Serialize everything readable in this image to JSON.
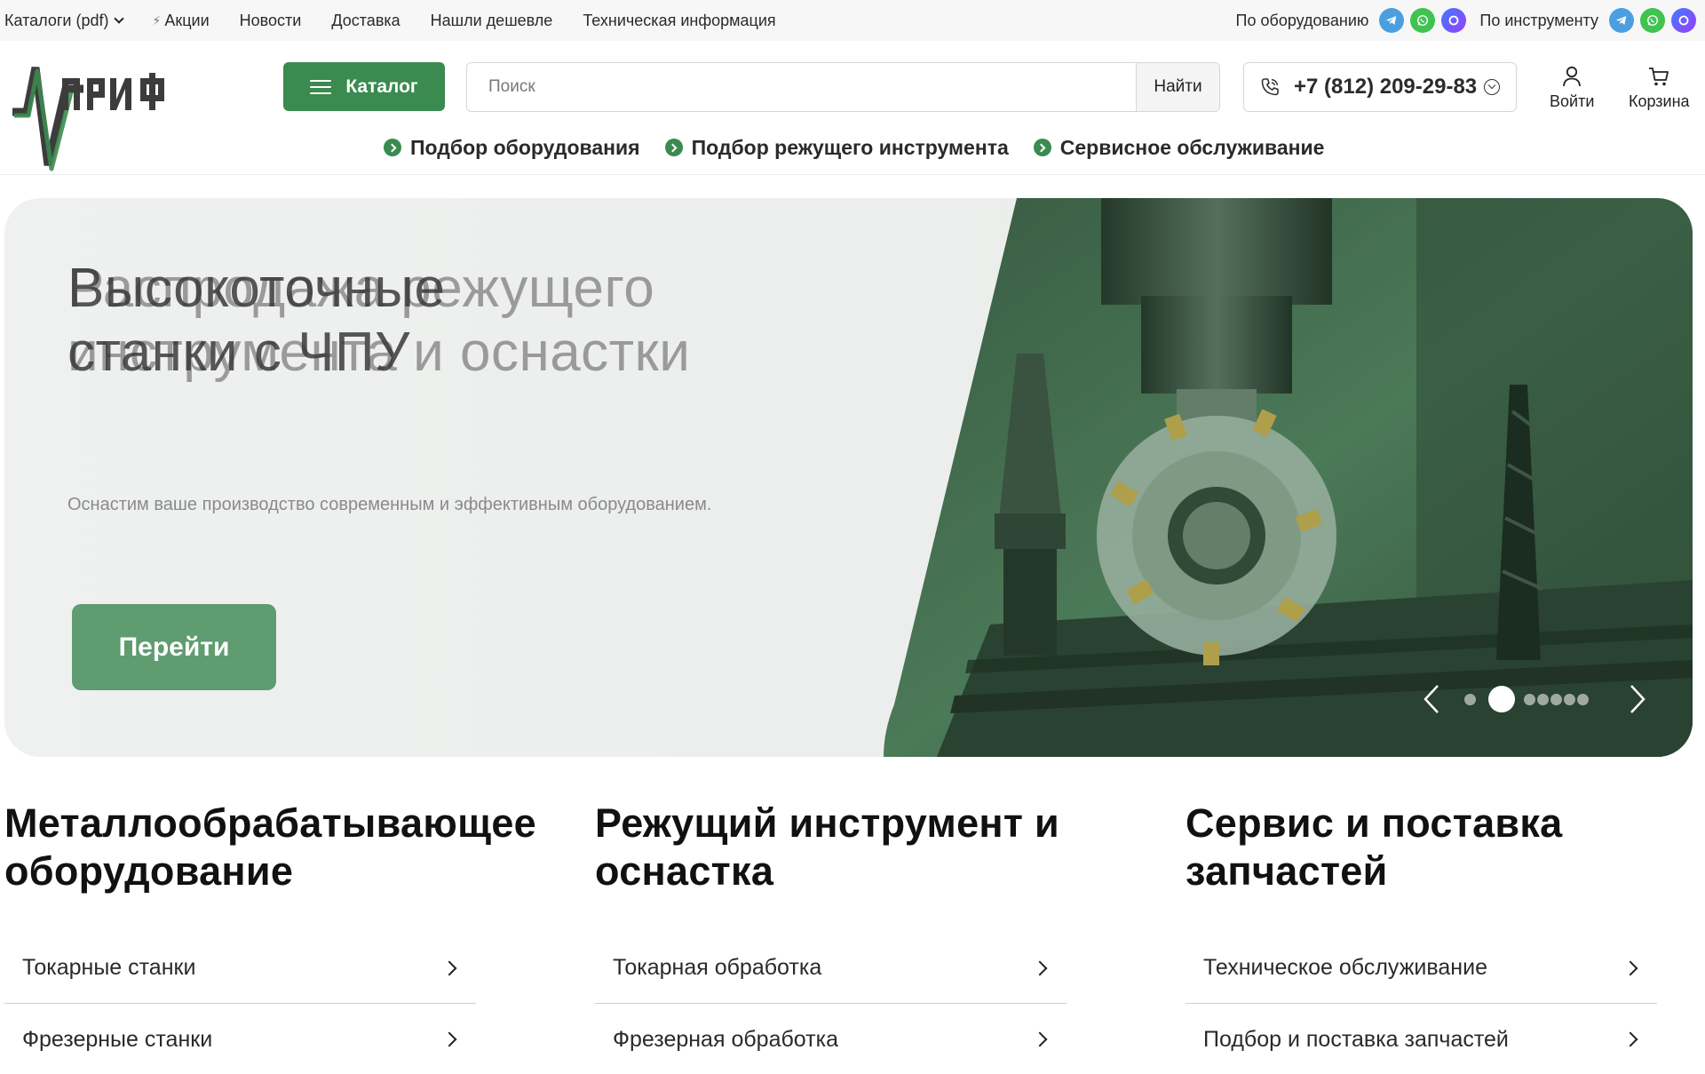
{
  "topbar": {
    "nav": [
      {
        "label": "Каталоги (pdf)",
        "has_dropdown": true
      },
      {
        "label": "Акции",
        "icon": "bolt-icon"
      },
      {
        "label": "Новости"
      },
      {
        "label": "Доставка"
      },
      {
        "label": "Нашли дешевле"
      },
      {
        "label": "Техническая информация"
      }
    ],
    "contacts": [
      {
        "label": "По оборудованию",
        "messengers": [
          "telegram-icon",
          "whatsapp-icon",
          "max-messenger-icon"
        ]
      },
      {
        "label": "По инструменту",
        "messengers": [
          "telegram-icon",
          "whatsapp-icon",
          "max-messenger-icon"
        ]
      }
    ]
  },
  "header": {
    "logo_alt": "Арифм",
    "catalog_label": "Каталог",
    "search": {
      "placeholder": "Поиск",
      "value": "",
      "button_label": "Найти"
    },
    "phone": "+7 (812) 209-29-83",
    "login_label": "Войти",
    "cart_label": "Корзина",
    "subnav": [
      {
        "label": "Подбор оборудования"
      },
      {
        "label": "Подбор режущего инструмента"
      },
      {
        "label": "Сервисное обслуживание"
      }
    ]
  },
  "hero": {
    "title_primary": "Распродажа режущего инструмента и оснастки",
    "title_secondary": "Высокоточные станки с ЧПУ",
    "subtitle": "Оснастим ваше производство современным и эффективным оборудованием.",
    "button_label": "Перейти",
    "slides_total": 7,
    "active_slide": 2
  },
  "categories": [
    {
      "title": "Металлообрабатывающее оборудование",
      "items": [
        {
          "label": "Токарные станки"
        },
        {
          "label": "Фрезерные станки"
        }
      ]
    },
    {
      "title": "Режущий инструмент и оснастка",
      "items": [
        {
          "label": "Токарная обработка"
        },
        {
          "label": "Фрезерная обработка"
        }
      ]
    },
    {
      "title": "Сервис и поставка запчастей",
      "items": [
        {
          "label": "Техническое обслуживание"
        },
        {
          "label": "Подбор и поставка запчастей"
        }
      ]
    }
  ],
  "colors": {
    "brand_green": "#3b8a4f",
    "hero_button": "#5f9c70",
    "topbar_bg": "#f7f7f7"
  }
}
